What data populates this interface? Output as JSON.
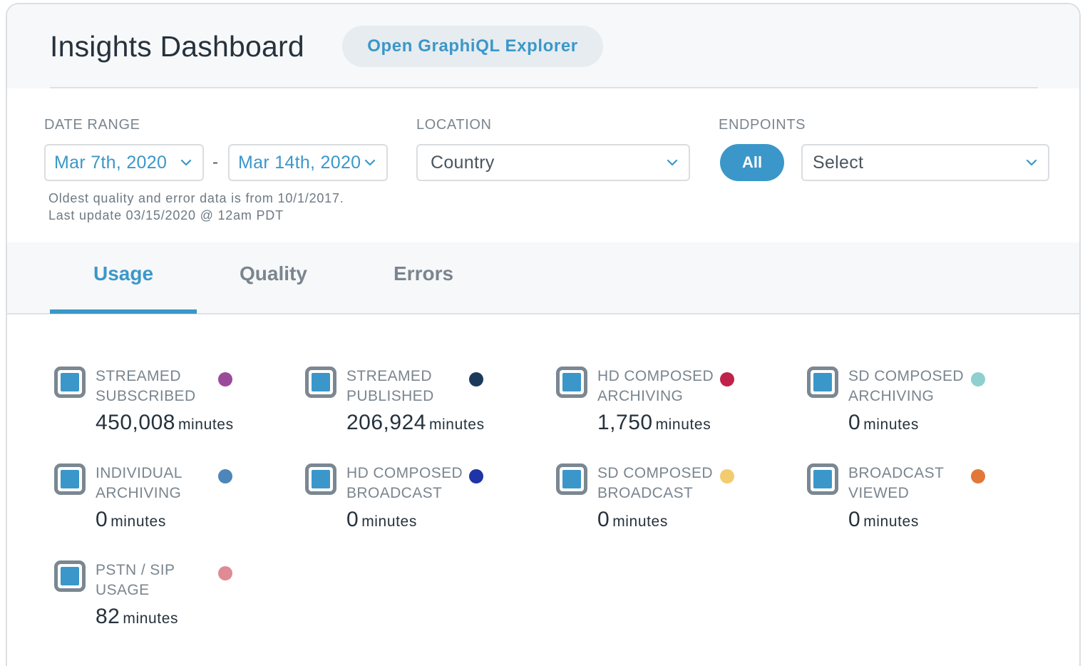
{
  "header": {
    "title": "Insights Dashboard",
    "graphiql_button": "Open GraphiQL Explorer"
  },
  "filters": {
    "date_range": {
      "label": "DATE RANGE",
      "start": "Mar 7th, 2020",
      "separator": "-",
      "end": "Mar 14th, 2020"
    },
    "notes": [
      "Oldest quality and error data is from 10/1/2017.",
      "Last update 03/15/2020 @ 12am PDT"
    ],
    "location": {
      "label": "LOCATION",
      "value": "Country"
    },
    "endpoints": {
      "label": "ENDPOINTS",
      "all_button": "All",
      "select_value": "Select"
    }
  },
  "tabs": [
    {
      "label": "Usage",
      "active": true
    },
    {
      "label": "Quality",
      "active": false
    },
    {
      "label": "Errors",
      "active": false
    }
  ],
  "colors": {
    "accent": "#3b97c9"
  },
  "metrics": [
    {
      "label": "STREAMED SUBSCRIBED",
      "value": "450,008",
      "unit": "minutes",
      "color": "#9b4a9a",
      "checked": true
    },
    {
      "label": "STREAMED PUBLISHED",
      "value": "206,924",
      "unit": "minutes",
      "color": "#1b3a5a",
      "checked": true
    },
    {
      "label": "HD COMPOSED ARCHIVING",
      "value": "1,750",
      "unit": "minutes",
      "color": "#c0234a",
      "checked": true
    },
    {
      "label": "SD COMPOSED ARCHIVING",
      "value": "0",
      "unit": "minutes",
      "color": "#8fcfcf",
      "checked": true
    },
    {
      "label": "INDIVIDUAL ARCHIVING",
      "value": "0",
      "unit": "minutes",
      "color": "#4d86b8",
      "checked": true
    },
    {
      "label": "HD COMPOSED BROADCAST",
      "value": "0",
      "unit": "minutes",
      "color": "#1f34a6",
      "checked": true
    },
    {
      "label": "SD COMPOSED BROADCAST",
      "value": "0",
      "unit": "minutes",
      "color": "#f2cc6e",
      "checked": true
    },
    {
      "label": "BROADCAST VIEWED",
      "value": "0",
      "unit": "minutes",
      "color": "#e2773a",
      "checked": true
    },
    {
      "label": "PSTN / SIP USAGE",
      "value": "82",
      "unit": "minutes",
      "color": "#e08a96",
      "checked": true
    }
  ]
}
